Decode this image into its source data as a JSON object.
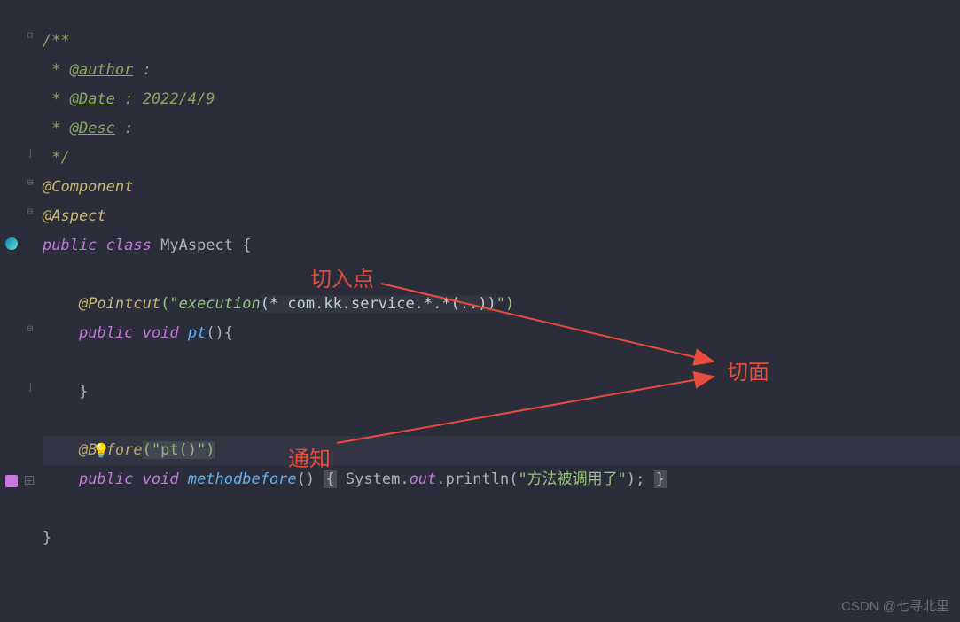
{
  "code": {
    "doc_open": "/**",
    "author_star": " * ",
    "author_tag": "@author",
    "author_colon": " :",
    "date_star": " * ",
    "date_tag": "@Date",
    "date_value": " : 2022/4/9",
    "desc_star": " * ",
    "desc_tag": "@Desc",
    "desc_colon": " :",
    "doc_close": " */",
    "component": "@Component",
    "aspect": "@Aspect",
    "public_kw": "public",
    "class_kw": "class",
    "class_name": "MyAspect",
    "brace_open": "{",
    "pointcut_anno": "@Pointcut",
    "pointcut_str_open": "(\"",
    "pointcut_exec": "execution",
    "pointcut_args": "(* com.kk.service.*.*(..))",
    "pointcut_str_close": "\")",
    "void_kw": "void",
    "pt_method": "pt",
    "empty_parens": "()",
    "brace_close": "}",
    "before_anno": "@Before",
    "before_str": "(\"pt()\")",
    "methodbefore": "methodbefore",
    "system": "System",
    "out_field": "out",
    "println": "println",
    "println_str": "\"方法被调用了\"",
    "semicolon": ";"
  },
  "labels": {
    "pointcut_label": "切入点",
    "aspect_label": "切面",
    "advice_label": "通知"
  },
  "watermark": "CSDN @七寻北里"
}
